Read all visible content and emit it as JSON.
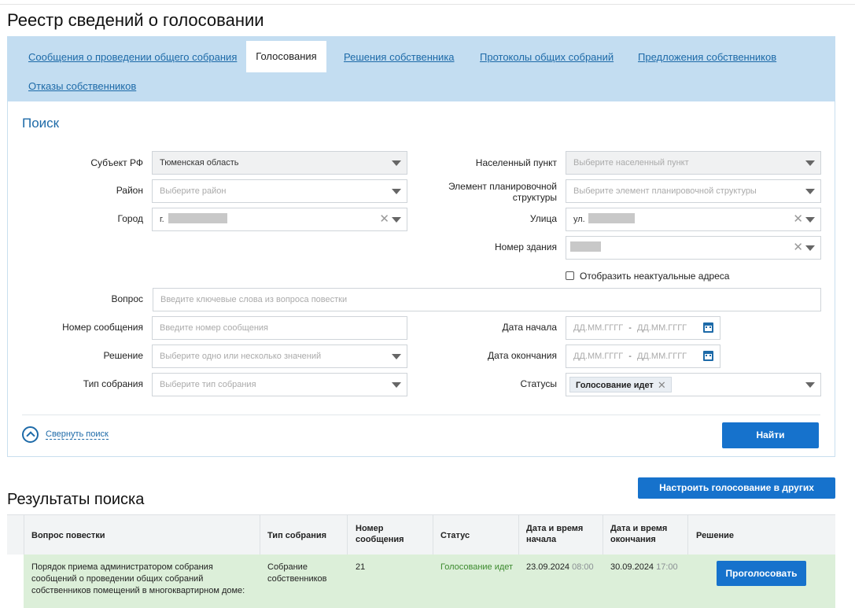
{
  "page": {
    "title": "Реестр сведений о голосовании"
  },
  "tabs": [
    {
      "label": "Сообщения о проведении общего собрания",
      "active": false
    },
    {
      "label": "Голосования",
      "active": true
    },
    {
      "label": "Решения собственника",
      "active": false
    },
    {
      "label": "Протоколы общих собраний",
      "active": false
    },
    {
      "label": "Предложения собственников",
      "active": false
    },
    {
      "label": "Отказы собственников",
      "active": false
    }
  ],
  "search": {
    "title": "Поиск",
    "subject": {
      "label": "Субъект РФ",
      "value": "Тюменская область"
    },
    "locality": {
      "label": "Населенный пункт",
      "placeholder": "Выберите населенный пункт"
    },
    "district": {
      "label": "Район",
      "placeholder": "Выберите район"
    },
    "planning": {
      "label": "Элемент планировочной структуры",
      "placeholder": "Выберите элемент планировочной структуры"
    },
    "city": {
      "label": "Город",
      "value": "г."
    },
    "street": {
      "label": "Улица",
      "value": "ул."
    },
    "building": {
      "label": "Номер здания"
    },
    "show_inactive": {
      "label": "Отобразить неактуальные адреса"
    },
    "question": {
      "label": "Вопрос",
      "placeholder": "Введите ключевые слова из вопроса повестки"
    },
    "message_no": {
      "label": "Номер сообщения",
      "placeholder": "Введите номер сообщения"
    },
    "start_date": {
      "label": "Дата начала",
      "from": "ДД.ММ.ГГГГ",
      "sep": "-",
      "to": "ДД.ММ.ГГГГ"
    },
    "decision": {
      "label": "Решение",
      "placeholder": "Выберите одно или несколько значений"
    },
    "end_date": {
      "label": "Дата окончания",
      "from": "ДД.ММ.ГГГГ",
      "sep": "-",
      "to": "ДД.ММ.ГГГГ"
    },
    "meeting_type": {
      "label": "Тип собрания",
      "placeholder": "Выберите тип собрания"
    },
    "statuses": {
      "label": "Статусы",
      "chip": "Голосование идет"
    },
    "collapse_label": "Свернуть поиск",
    "find_button": "Найти"
  },
  "configure_button": "Настроить голосование в других системах",
  "results": {
    "title": "Результаты поиска",
    "headers": {
      "question": "Вопрос повестки",
      "type": "Тип собрания",
      "number_l1": "Номер",
      "number_l2": "сообщения",
      "status": "Статус",
      "start_l1": "Дата и время",
      "start_l2": "начала",
      "end_l1": "Дата и время",
      "end_l2": "окончания",
      "decision": "Решение"
    },
    "rows": [
      {
        "question_l1": "Порядок приема администратором собрания",
        "question_l2": "сообщений о проведении общих собраний",
        "question_l3": "собственников помещений в многоквартирном доме:",
        "type_l1": "Собрание",
        "type_l2": "собственников",
        "number": "21",
        "status": "Голосование идет",
        "start_date": "23.09.2024",
        "start_time": "08:00",
        "end_date": "30.09.2024",
        "end_time": "17:00",
        "vote_button": "Проголосовать"
      }
    ]
  }
}
